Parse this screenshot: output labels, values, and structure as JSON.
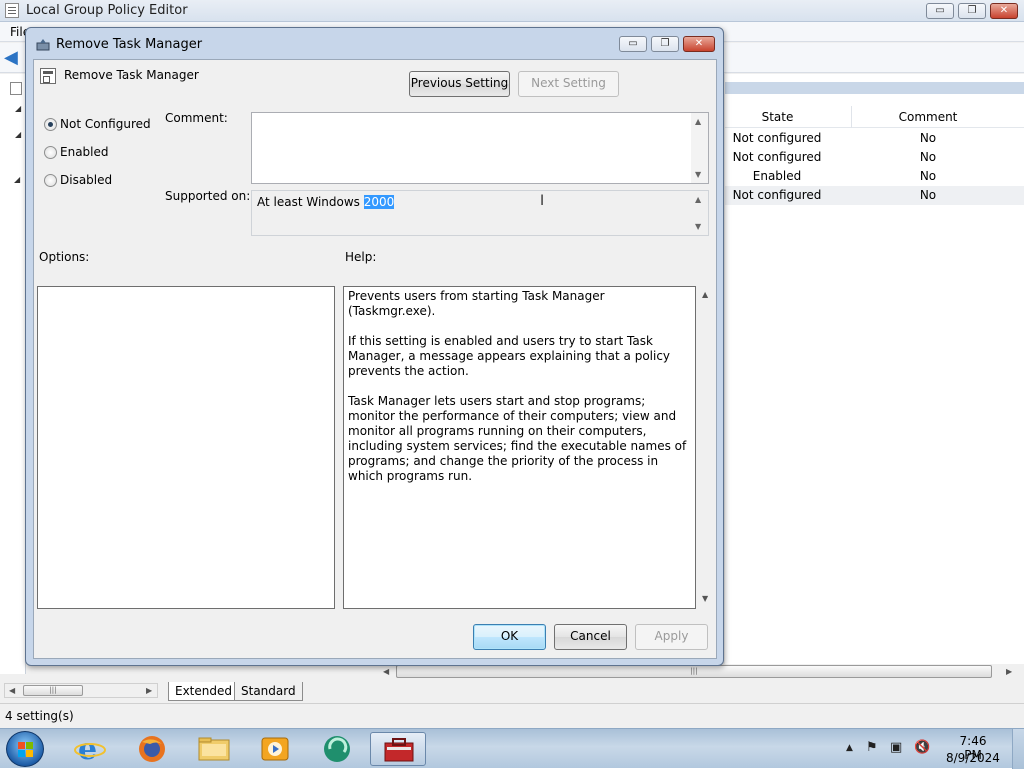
{
  "main_window": {
    "title": "Local Group Policy Editor",
    "menu_file": "File",
    "caption": {
      "minimize": "▭",
      "restore": "❐",
      "close": "✕"
    },
    "list": {
      "columns": [
        "State",
        "Comment"
      ],
      "rows": [
        {
          "state": "Not configured",
          "comment": "No"
        },
        {
          "state": "Not configured",
          "comment": "No"
        },
        {
          "state": "Enabled",
          "comment": "No"
        },
        {
          "state": "Not configured",
          "comment": "No"
        }
      ]
    },
    "tabs": [
      "Extended",
      "Standard"
    ],
    "status": "4 setting(s)"
  },
  "dialog": {
    "title": "Remove Task Manager",
    "policy_name": "Remove Task Manager",
    "buttons": {
      "previous": "Previous Setting",
      "next": "Next Setting",
      "ok": "OK",
      "cancel": "Cancel",
      "apply": "Apply"
    },
    "radios": [
      {
        "label": "Not Configured",
        "checked": true
      },
      {
        "label": "Enabled",
        "checked": false
      },
      {
        "label": "Disabled",
        "checked": false
      }
    ],
    "labels": {
      "comment": "Comment:",
      "supported_on": "Supported on:",
      "options": "Options:",
      "help": "Help:"
    },
    "supported_value_prefix": "At least Windows ",
    "supported_value_selected": "2000",
    "help_paragraphs": [
      "Prevents users from starting Task Manager (Taskmgr.exe).",
      "If this setting is enabled and users try to start Task Manager, a message appears explaining that a policy prevents the action.",
      "Task Manager lets users start and stop programs; monitor the performance of their computers; view and monitor all programs running on their computers, including system services; find the executable names of programs; and change the priority of the process in which programs run."
    ]
  },
  "taskbar": {
    "time": "7:46 PM",
    "date": "8/9/2024",
    "pinned": [
      "internet-explorer",
      "firefox",
      "file-explorer",
      "media-player",
      "app-green",
      "group-policy-app"
    ]
  },
  "colors": {
    "accent": "#3399ff",
    "dialog_frame": "#c7d6ea",
    "close_button": "#c8432f"
  }
}
